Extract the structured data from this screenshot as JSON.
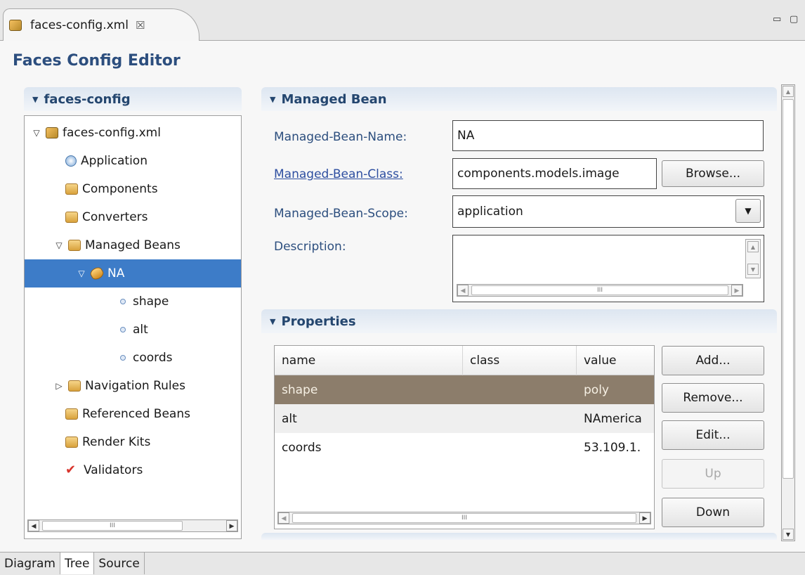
{
  "tab": {
    "title": "faces-config.xml",
    "close_glyph": "☒",
    "minimize_glyph": "▭",
    "maximize_glyph": "▢"
  },
  "editor_title": "Faces Config Editor",
  "tree": {
    "section_title": "faces-config",
    "root": "faces-config.xml",
    "items": [
      {
        "label": "Application",
        "icon": "application-icon"
      },
      {
        "label": "Components",
        "icon": "folder-icon"
      },
      {
        "label": "Converters",
        "icon": "folder-icon"
      },
      {
        "label": "Managed Beans",
        "icon": "folder-icon"
      },
      {
        "label": "NA",
        "icon": "bean-icon"
      },
      {
        "label": "shape",
        "icon": "property-icon"
      },
      {
        "label": "alt",
        "icon": "property-icon"
      },
      {
        "label": "coords",
        "icon": "property-icon"
      },
      {
        "label": "Navigation Rules",
        "icon": "folder-icon"
      },
      {
        "label": "Referenced Beans",
        "icon": "folder-icon"
      },
      {
        "label": "Render Kits",
        "icon": "folder-icon"
      },
      {
        "label": "Validators",
        "icon": "validator-icon"
      }
    ]
  },
  "managed_bean": {
    "section_title": "Managed Bean",
    "name_label": "Managed-Bean-Name:",
    "name_value": "NA",
    "class_label": "Managed-Bean-Class:",
    "class_value": "components.models.image",
    "browse_label": "Browse...",
    "scope_label": "Managed-Bean-Scope:",
    "scope_value": "application",
    "description_label": "Description:",
    "description_value": ""
  },
  "properties": {
    "section_title": "Properties",
    "columns": [
      "name",
      "class",
      "value"
    ],
    "rows": [
      {
        "name": "shape",
        "class": "",
        "value": "poly"
      },
      {
        "name": "alt",
        "class": "",
        "value": "NAmerica"
      },
      {
        "name": "coords",
        "class": "",
        "value": "53.109.1."
      }
    ],
    "buttons": {
      "add": "Add...",
      "remove": "Remove...",
      "edit": "Edit...",
      "up": "Up",
      "down": "Down"
    }
  },
  "bottom_tabs": [
    "Diagram",
    "Tree",
    "Source"
  ],
  "scroll_grip": "III"
}
